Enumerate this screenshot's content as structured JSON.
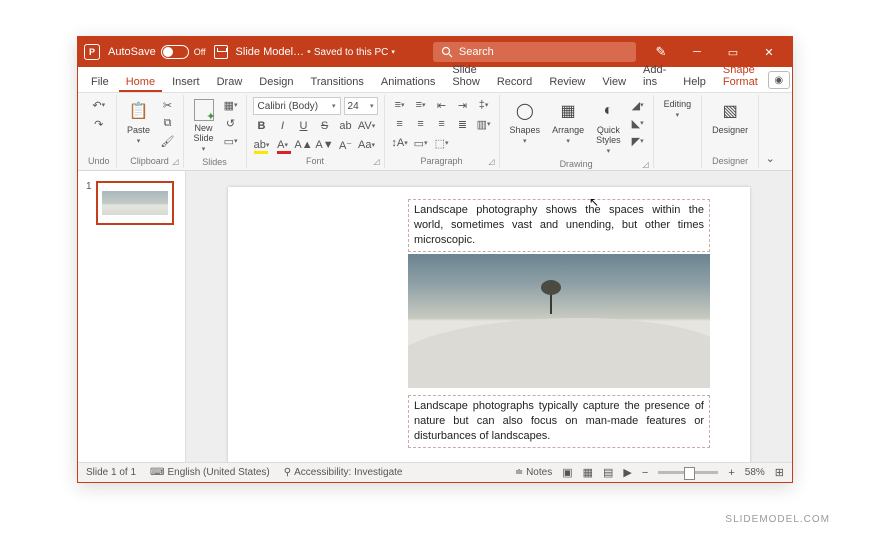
{
  "titlebar": {
    "autosave_label": "AutoSave",
    "autosave_state": "Off",
    "doc_name": "Slide Model…",
    "saved_state": "Saved to this PC",
    "search_placeholder": "Search"
  },
  "tabs": {
    "file": "File",
    "home": "Home",
    "insert": "Insert",
    "draw": "Draw",
    "design": "Design",
    "transitions": "Transitions",
    "animations": "Animations",
    "slideshow": "Slide Show",
    "record": "Record",
    "review": "Review",
    "view": "View",
    "addins": "Add-ins",
    "help": "Help",
    "shapeformat": "Shape Format"
  },
  "ribbon": {
    "undo_group": "Undo",
    "clipboard_group": "Clipboard",
    "paste_label": "Paste",
    "slides_group": "Slides",
    "newslide_label": "New\nSlide",
    "font_group": "Font",
    "font_name": "Calibri (Body)",
    "font_size": "24",
    "paragraph_group": "Paragraph",
    "drawing_group": "Drawing",
    "shapes_label": "Shapes",
    "arrange_label": "Arrange",
    "quick_label": "Quick\nStyles",
    "editing_label": "Editing",
    "designer_label": "Designer",
    "designer_group": "Designer"
  },
  "slide": {
    "text_top": "Landscape photography shows the spaces within the world, sometimes vast and unending, but other times microscopic.",
    "text_bottom": "Landscape photographs typically capture the presence of nature but can also focus on man-made features or disturbances of landscapes."
  },
  "thumbs": {
    "slide1_num": "1"
  },
  "status": {
    "slide_pos": "Slide 1 of 1",
    "language": "English (United States)",
    "accessibility": "Accessibility: Investigate",
    "notes": "Notes",
    "zoom": "58%"
  },
  "watermark": "SLIDEMODEL.COM"
}
